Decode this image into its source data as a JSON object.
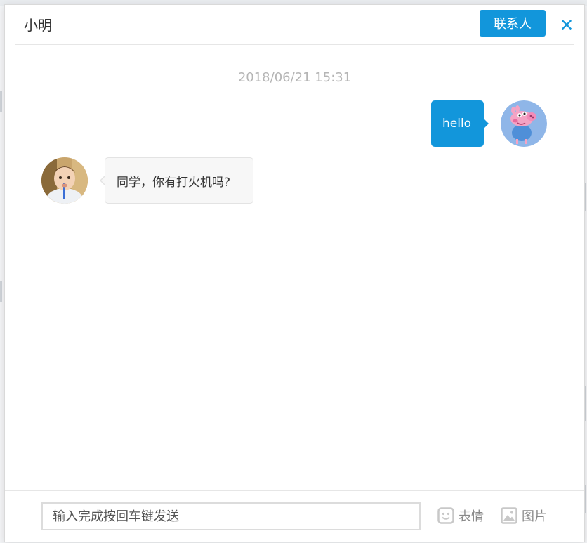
{
  "header": {
    "title": "小明",
    "contacts_label": "联系人",
    "close_symbol": "✕"
  },
  "conversation": {
    "timestamp": "2018/06/21 15:31",
    "messages": [
      {
        "side": "right",
        "text": "hello",
        "avatar": "peppa-pig-avatar"
      },
      {
        "side": "left",
        "text": "同学，你有打火机吗?",
        "avatar": "child-photo-avatar"
      }
    ]
  },
  "composer": {
    "input_placeholder": "输入完成按回车键发送",
    "input_value": "",
    "emoji_label": "表情",
    "image_label": "图片"
  },
  "colors": {
    "accent": "#1296db",
    "timestamp_text": "#b5b5b5",
    "incoming_bubble": "#f7f7f7"
  }
}
